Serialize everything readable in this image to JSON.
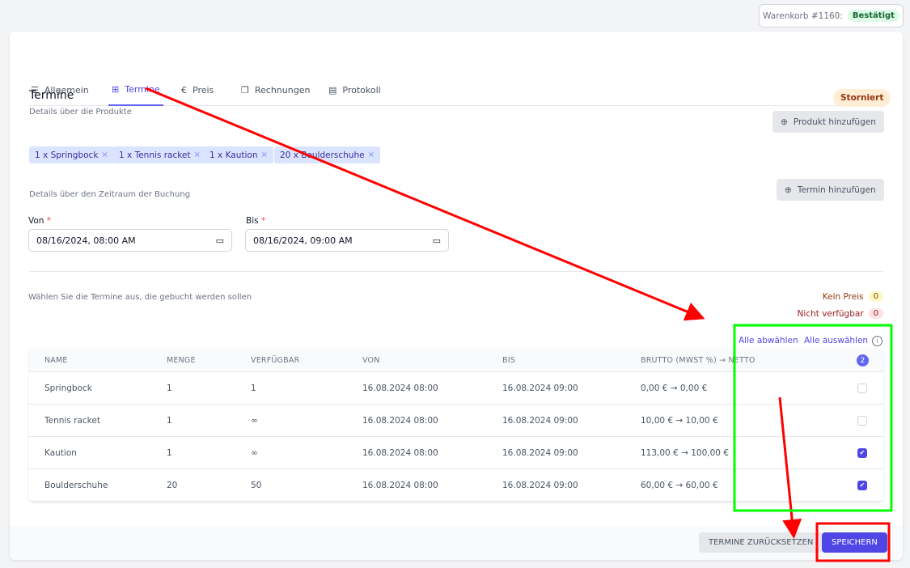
{
  "cart": {
    "label": "Warenkorb #1160:",
    "status": "Bestätigt",
    "status_color": "#166534"
  },
  "tabs": [
    {
      "label": "Allgemein",
      "icon": "menu-lines-icon"
    },
    {
      "label": "Termine",
      "icon": "grid-icon",
      "active": true
    },
    {
      "label": "Preis",
      "icon": "euro-circle-icon"
    },
    {
      "label": "Rechnungen",
      "icon": "documents-icon"
    },
    {
      "label": "Protokoll",
      "icon": "clipboard-icon"
    }
  ],
  "section": {
    "title": "Termine",
    "subtitle": "Details über die Produkte",
    "status": "Storniert",
    "add_product": "Produkt hinzufügen"
  },
  "chips": [
    "1 x Springbock",
    "1 x Tennis racket",
    "1 x Kaution",
    "20 x Boulderschuhe"
  ],
  "period": {
    "subtitle": "Details über den Zeitraum der Buchung",
    "add_term": "Termin hinzufügen",
    "from_label": "Von",
    "from_value": "08/16/2024, 08:00 AM",
    "to_label": "Bis",
    "to_value": "08/16/2024, 09:00 AM",
    "required": "*"
  },
  "selection": {
    "hint": "Wählen Sie die Termine aus, die gebucht werden sollen",
    "no_price_label": "Kein Preis",
    "no_price_count": "0",
    "unavailable_label": "Nicht verfügbar",
    "unavailable_count": "0",
    "deselect_all": "Alle abwählen",
    "select_all": "Alle auswählen",
    "selected_count": "2"
  },
  "table": {
    "columns": [
      "NAME",
      "MENGE",
      "VERFÜGBAR",
      "VON",
      "BIS",
      "BRUTTO (MWST %) → NETTO"
    ],
    "rows": [
      {
        "name": "Springbock",
        "qty": "1",
        "avail": "1",
        "from": "16.08.2024 08:00",
        "to": "16.08.2024 09:00",
        "price": "0,00 € → 0,00 €",
        "checked": false
      },
      {
        "name": "Tennis racket",
        "qty": "1",
        "avail": "∞",
        "from": "16.08.2024 08:00",
        "to": "16.08.2024 09:00",
        "price": "10,00 € → 10,00 €",
        "checked": false
      },
      {
        "name": "Kaution",
        "qty": "1",
        "avail": "∞",
        "from": "16.08.2024 08:00",
        "to": "16.08.2024 09:00",
        "price": "113,00 € → 100,00 €",
        "checked": true
      },
      {
        "name": "Boulderschuhe",
        "qty": "20",
        "avail": "50",
        "from": "16.08.2024 08:00",
        "to": "16.08.2024 09:00",
        "price": "60,00 € → 60,00 €",
        "checked": true
      }
    ]
  },
  "footer": {
    "reset": "TERMINE ZURÜCKSETZEN",
    "save": "SPEICHERN"
  },
  "colors": {
    "accent": "#4f46e5",
    "annotation_red": "#ff0000",
    "annotation_green": "#00ff00"
  }
}
